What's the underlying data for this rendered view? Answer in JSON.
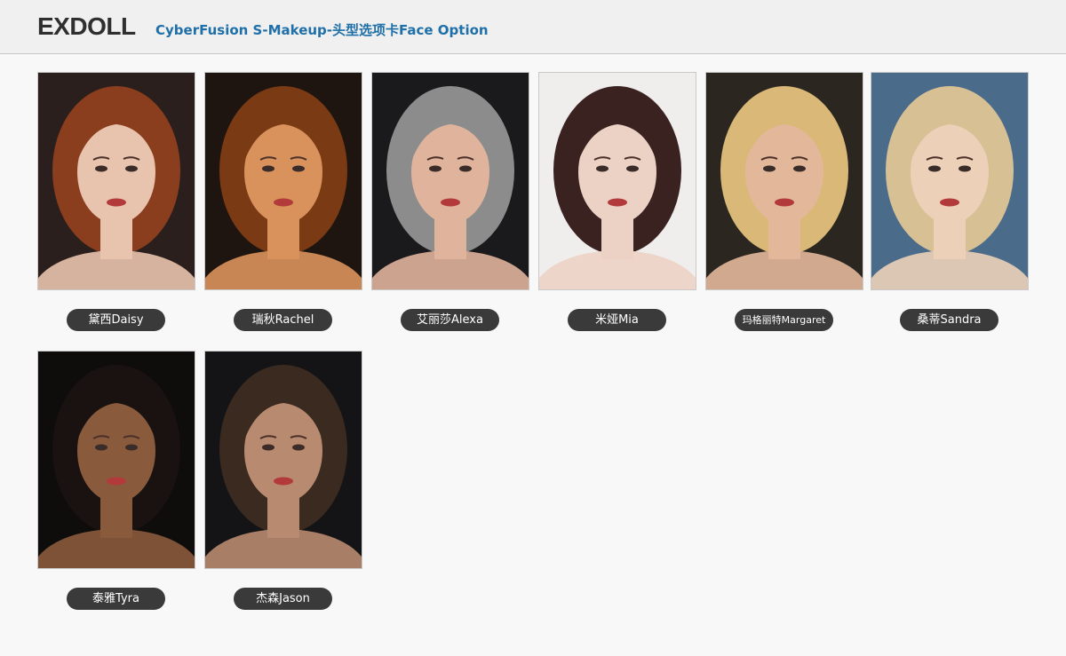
{
  "header": {
    "logo": "EXDOLL",
    "title": "CyberFusion S-Makeup-头型选项卡Face Option"
  },
  "faces": [
    {
      "label": "黛西Daisy",
      "bg": "#2a1f1c",
      "hair": "#8a3e1e",
      "skin": "#e8c3ad"
    },
    {
      "label": "瑞秋Rachel",
      "bg": "#1e1510",
      "hair": "#7a3a14",
      "skin": "#d9925c"
    },
    {
      "label": "艾丽莎Alexa",
      "bg": "#1a1a1c",
      "hair": "#8c8c8c",
      "skin": "#e0b39c"
    },
    {
      "label": "米娅Mia",
      "bg": "#f0eeec",
      "hair": "#3a2220",
      "skin": "#ecd2c5"
    },
    {
      "label": "玛格丽特Margaret",
      "bg": "#2b2620",
      "hair": "#d9b878",
      "skin": "#e3b89a"
    },
    {
      "label": "桑蒂Sandra",
      "bg": "#4a6b8a",
      "hair": "#d8c095",
      "skin": "#ecd0b8"
    },
    {
      "label": "泰雅Tyra",
      "bg": "#0f0d0c",
      "hair": "#1a1210",
      "skin": "#8a5a3c"
    },
    {
      "label": "杰森Jason",
      "bg": "#141416",
      "hair": "#3a2a20",
      "skin": "#b88a70"
    }
  ]
}
